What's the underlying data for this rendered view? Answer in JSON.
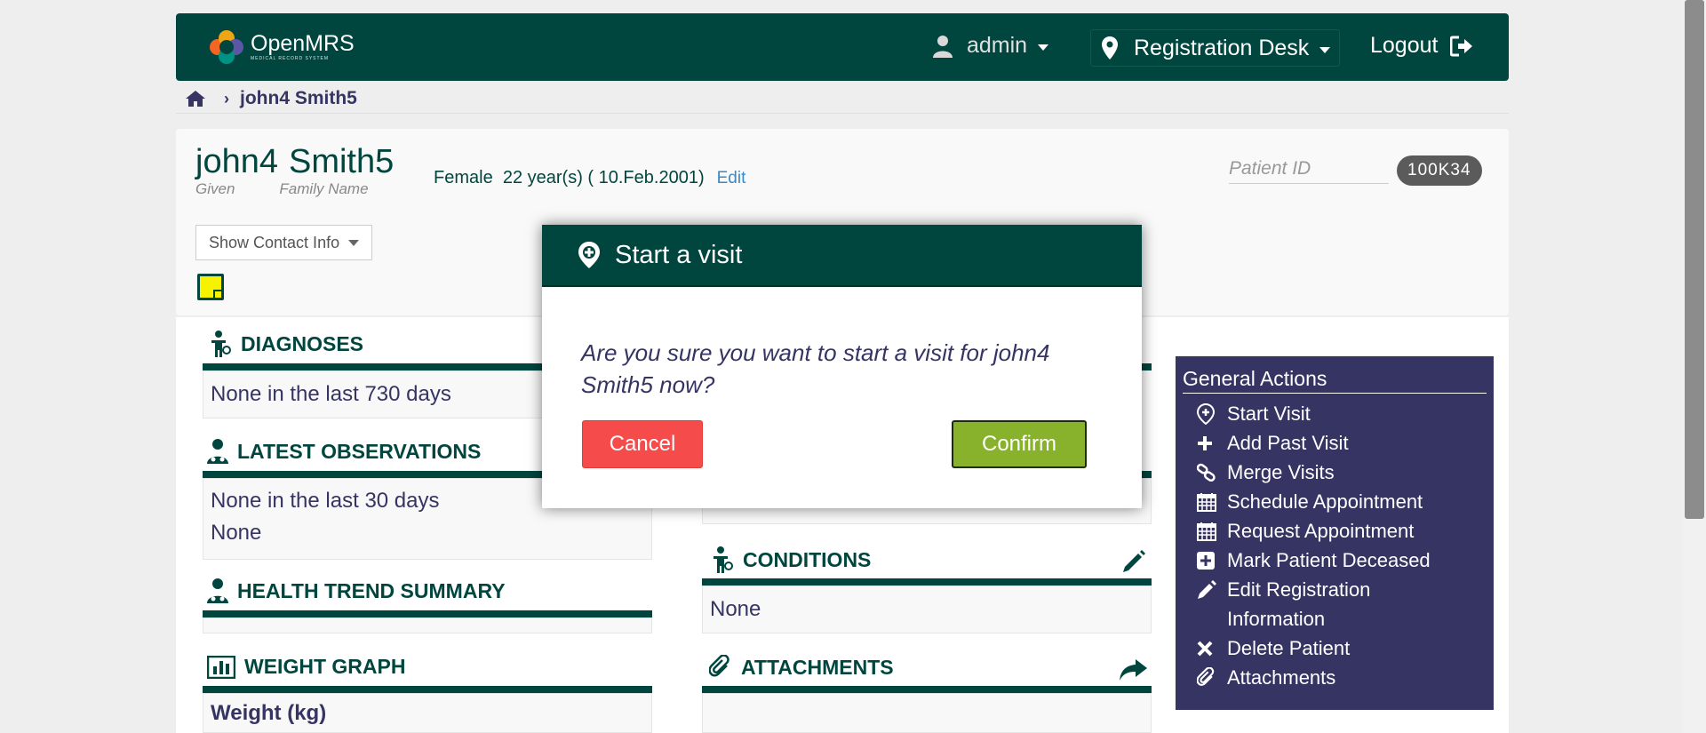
{
  "header": {
    "logo_name": "OpenMRS",
    "logo_sub": "MEDICAL RECORD SYSTEM",
    "user": "admin",
    "location": "Registration Desk",
    "logout": "Logout"
  },
  "breadcrumb": {
    "current": "john4 Smith5"
  },
  "patient": {
    "given_name": "john4",
    "family_name": "Smith5",
    "given_label": "Given",
    "family_label": "Family Name",
    "gender": "Female",
    "age_dob": "22 year(s) ( 10.Feb.2001)",
    "edit_label": "Edit",
    "patient_id_label": "Patient ID",
    "patient_id": "100K34",
    "contact_btn": "Show Contact Info"
  },
  "sections": {
    "diagnoses": {
      "title": "DIAGNOSES",
      "body": "None in the last 730 days"
    },
    "observations": {
      "title": "LATEST OBSERVATIONS",
      "line1": "None in the last 30 days",
      "line2": "None"
    },
    "health_trend": {
      "title": "HEALTH TREND SUMMARY"
    },
    "weight_graph": {
      "title": "WEIGHT GRAPH",
      "body": "Weight (kg)"
    },
    "conditions": {
      "title": "CONDITIONS",
      "body": "None"
    },
    "attachments": {
      "title": "ATTACHMENTS"
    }
  },
  "general_actions": {
    "title": "General Actions",
    "items": [
      {
        "label": "Start Visit",
        "icon": "start-visit-icon"
      },
      {
        "label": "Add Past Visit",
        "icon": "plus-icon"
      },
      {
        "label": "Merge Visits",
        "icon": "link-icon"
      },
      {
        "label": "Schedule Appointment",
        "icon": "calendar-icon"
      },
      {
        "label": "Request Appointment",
        "icon": "calendar-icon"
      },
      {
        "label": "Mark Patient Deceased",
        "icon": "plus-square-icon"
      },
      {
        "label": "Edit Registration Information",
        "icon": "pencil-icon"
      },
      {
        "label": "Delete Patient",
        "icon": "close-icon"
      },
      {
        "label": "Attachments",
        "icon": "paperclip-icon"
      }
    ]
  },
  "modal": {
    "title": "Start a visit",
    "question": "Are you sure you want to start a visit for john4 Smith5 now?",
    "cancel": "Cancel",
    "confirm": "Confirm"
  },
  "colors": {
    "brand_green": "#00463f",
    "brand_purple": "#363463",
    "cancel_red": "#f54b4b",
    "confirm_green": "#88b22c"
  }
}
